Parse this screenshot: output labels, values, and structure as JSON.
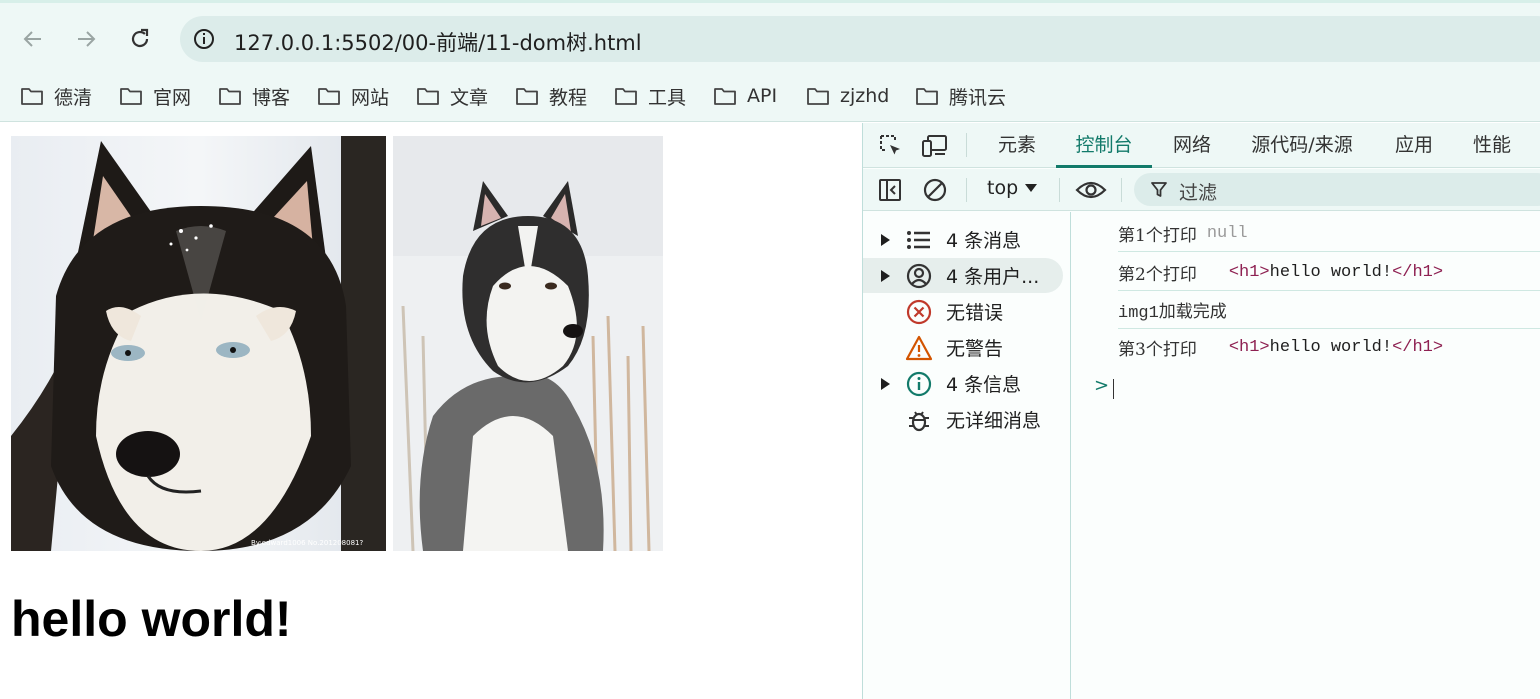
{
  "browser": {
    "url": "127.0.0.1:5502/00-前端/11-dom树.html",
    "bookmarks": [
      "德清",
      "官网",
      "博客",
      "网站",
      "文章",
      "教程",
      "工具",
      "API",
      "zjzhd",
      "腾讯云"
    ]
  },
  "page": {
    "heading": "hello world!",
    "images": [
      "husky-face-photo",
      "husky-sitting-photo"
    ],
    "image_watermark": "By:edward1006 No.201208081?"
  },
  "devtools": {
    "tabs": [
      "元素",
      "控制台",
      "网络",
      "源代码/来源",
      "应用",
      "性能"
    ],
    "active_tab": "控制台",
    "context": "top",
    "filter_placeholder": "过滤",
    "sidebar": [
      {
        "label": "4 条消息",
        "icon": "list-icon"
      },
      {
        "label": "4 条用户...",
        "icon": "user-icon"
      },
      {
        "label": "无错误",
        "icon": "error-icon"
      },
      {
        "label": "无警告",
        "icon": "warning-icon"
      },
      {
        "label": "4 条信息",
        "icon": "info-icon"
      },
      {
        "label": "无详细消息",
        "icon": "bug-icon"
      }
    ],
    "console": [
      {
        "text": "第1个打印",
        "value": "null"
      },
      {
        "text": "第2个打印",
        "open_tag": "<h1>",
        "content": "hello world!",
        "close_tag": "</h1>"
      },
      {
        "text": "img1加载完成"
      },
      {
        "text": "第3个打印",
        "open_tag": "<h1>",
        "content": "hello world!",
        "close_tag": "</h1>"
      }
    ],
    "prompt_symbol": ">"
  },
  "colors": {
    "chrome_bg": "#eef8f6",
    "accent": "#127a6a",
    "tag": "#8e2152"
  }
}
